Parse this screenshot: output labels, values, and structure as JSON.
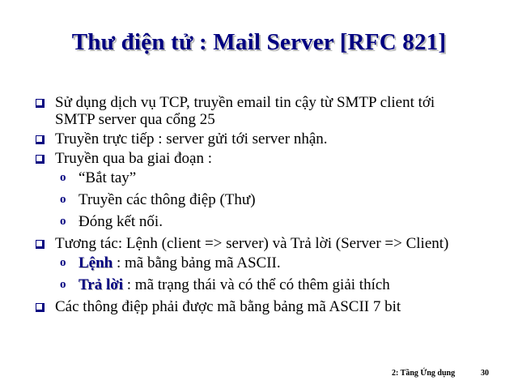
{
  "slide": {
    "title": "Thư điện tử : Mail Server [RFC 821]",
    "bullets": [
      "Sử dụng dịch vụ TCP, truyền email tin cậy từ SMTP client tới SMTP server qua cổng 25",
      "Truyền trực tiếp : server gửi tới server nhận.",
      "Truyền qua ba giai đoạn :",
      "Tương tác: Lệnh (client => server) và Trả lời (Server => Client)",
      "Các thông điệp phải được mã bằng bảng mã ASCII 7 bit"
    ],
    "subbullet_marker": "o",
    "phases": [
      "“Bắt tay”",
      "Truyền các thông điệp (Thư)",
      "Đóng kết nối."
    ],
    "interaction": [
      {
        "keyword": "Lệnh",
        "text": " : mã bằng bảng mã ASCII."
      },
      {
        "keyword": "Trả lời",
        "text": " : mã trạng thái và có thể có thêm giải thích"
      }
    ]
  },
  "footer": {
    "section": "2: Tầng Ứng dụng",
    "page": "30"
  },
  "colors": {
    "title": "#000080",
    "bullet": "#000080",
    "keyword": "#000080",
    "text": "#000000",
    "background": "#ffffff"
  }
}
